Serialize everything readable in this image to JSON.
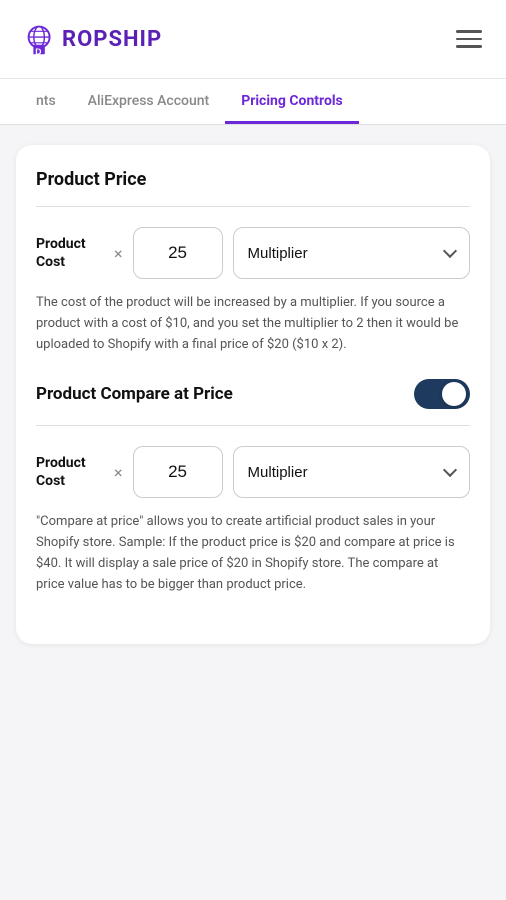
{
  "header": {
    "logo_text": "ROPSHIP",
    "logo_d": "D"
  },
  "tabs": {
    "items": [
      {
        "id": "nts",
        "label": "nts",
        "active": false
      },
      {
        "id": "aliexpress",
        "label": "AliExpress Account",
        "active": false
      },
      {
        "id": "pricing",
        "label": "Pricing Controls",
        "active": true
      }
    ]
  },
  "product_price": {
    "section_title": "Product Price",
    "cost_label_line1": "Product",
    "cost_label_line2": "Cost",
    "multiply_symbol": "×",
    "input_value": "25",
    "dropdown_label": "Multiplier",
    "description": "The cost of the product will be increased by a multiplier. If you source a product with a cost of $10, and you set the multiplier to 2 then it would be uploaded to Shopify with a final price of $20 ($10 x 2)."
  },
  "compare_price": {
    "toggle_label": "Product Compare at Price",
    "toggle_enabled": true,
    "cost_label_line1": "Product",
    "cost_label_line2": "Cost",
    "multiply_symbol": "×",
    "input_value": "25",
    "dropdown_label": "Multiplier",
    "description": "\"Compare at price\" allows you to create artificial product sales in your Shopify store. Sample: If the product price is $20 and compare at price is $40. It will display a sale price of $20 in Shopify store. The compare at price value has to be bigger than product price."
  }
}
